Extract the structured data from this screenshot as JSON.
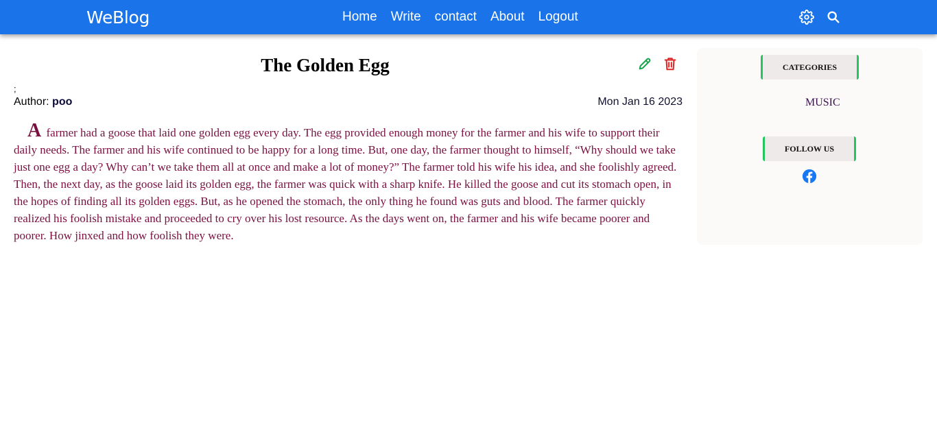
{
  "header": {
    "brand": "WeBlog",
    "nav": [
      {
        "label": "Home"
      },
      {
        "label": "Write"
      },
      {
        "label": "contact"
      },
      {
        "label": "About"
      },
      {
        "label": "Logout"
      }
    ],
    "icons": [
      "settings-icon",
      "search-icon"
    ]
  },
  "post": {
    "title": "The Golden Egg",
    "semicolon": ";",
    "author_label": "Author:",
    "author_name": "poo",
    "date": "Mon Jan 16 2023",
    "drop_letter": "A",
    "body": "farmer had a goose that laid one golden egg every day. The egg provided enough money for the farmer and his wife to support their daily needs. The farmer and his wife continued to be happy for a long time. But, one day, the farmer thought to himself, “Why should we take just one egg a day? Why can’t we take them all at once and make a lot of money?” The farmer told his wife his idea, and she foolishly agreed. Then, the next day, as the goose laid its golden egg, the farmer was quick with a sharp knife. He killed the goose and cut its stomach open, in the hopes of finding all its golden eggs. But, as he opened the stomach, the only thing he found was guts and blood. The farmer quickly realized his foolish mistake and proceeded to cry over his lost resource. As the days went on, the farmer and his wife became poorer and poorer. How jinxed and how foolish they were.",
    "action_icons": [
      "edit-icon",
      "delete-icon"
    ]
  },
  "sidebar": {
    "categories_title": "CATEGORIES",
    "categories": [
      {
        "label": "MUSIC"
      }
    ],
    "follow_title": "FOLLOW US",
    "social_icons": [
      "facebook-icon"
    ]
  },
  "colors": {
    "topbar": "#1a73e8",
    "body_text": "#7a1040",
    "edit": "#16a34a",
    "delete": "#dc2626",
    "accent_border": "#22c55e",
    "facebook": "#1877f2"
  }
}
